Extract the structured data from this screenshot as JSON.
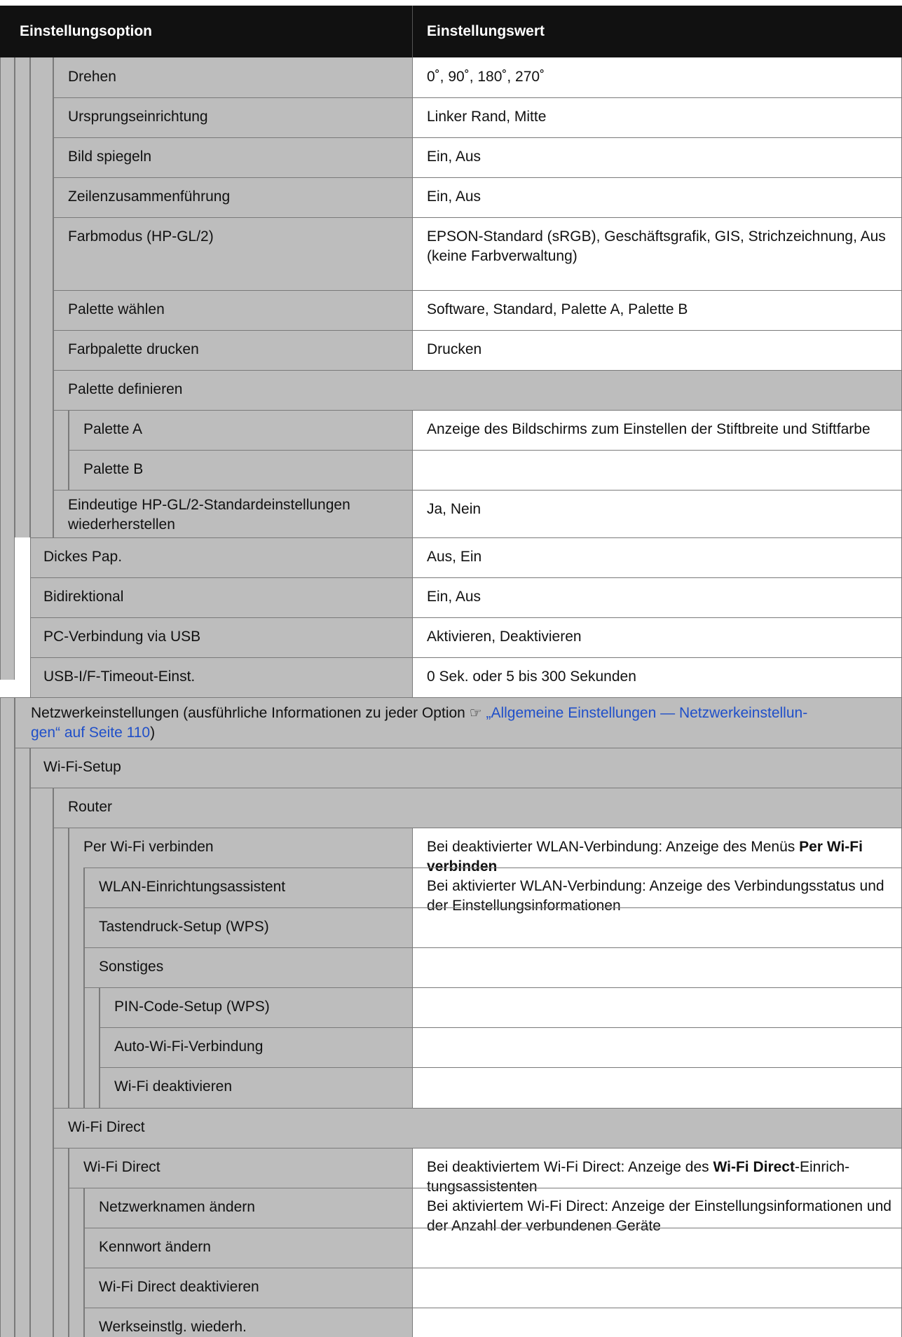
{
  "header": {
    "option": "Einstellungsoption",
    "value": "Einstellungswert"
  },
  "rows": {
    "drehen": {
      "option": "Drehen",
      "value": "0˚, 90˚, 180˚, 270˚"
    },
    "ursprung": {
      "option": "Ursprungseinrichtung",
      "value": "Linker Rand, Mitte"
    },
    "spiegeln": {
      "option": "Bild spiegeln",
      "value": "Ein, Aus"
    },
    "zeilen": {
      "option": "Zeilenzusammenführung",
      "value": "Ein, Aus"
    },
    "farbmodus": {
      "option": "Farbmodus (HP-GL/2)",
      "value": "EPSON-Standard (sRGB), Geschäftsgrafik, GIS, Strichzeichnung, Aus (keine Farbverwaltung)"
    },
    "palette_waehlen": {
      "option": "Palette wählen",
      "value": "Software, Standard, Palette A, Palette B"
    },
    "farbpalette": {
      "option": "Farbpalette drucken",
      "value": "Drucken"
    },
    "palette_def": {
      "option": "Palette definieren"
    },
    "palette_a": {
      "option": "Palette A"
    },
    "palette_b": {
      "option": "Palette B"
    },
    "palette_ab_value": "Anzeige des Bildschirms zum Einstellen der Stiftbreite und Stiftfarbe",
    "eindeutig": {
      "option": "Eindeutige HP-GL/2-Standardeinstellungen wiederherstellen",
      "value": "Ja, Nein"
    },
    "dickes": {
      "option": "Dickes Pap.",
      "value": "Aus, Ein"
    },
    "bidi": {
      "option": "Bidirektional",
      "value": "Ein, Aus"
    },
    "pc_usb": {
      "option": "PC-Verbindung via USB",
      "value": "Aktivieren, Deaktivieren"
    },
    "usb_timeout": {
      "option": "USB-I/F-Timeout-Einst.",
      "value": "0 Sek. oder 5 bis 300 Sekunden"
    }
  },
  "netzwerk": {
    "text": "Netzwerkeinstellungen (ausführliche Informationen zu jeder Option",
    "icon": "pointing-hand-icon",
    "link_text_1": "„Allgemeine Einstellungen — Netzwerkeinstellun-",
    "link_text_2": "gen“ auf Seite 110",
    "close": ")"
  },
  "wifi": {
    "setup": "Wi-Fi-Setup",
    "router": "Router",
    "per_wifi": "Per Wi-Fi verbinden",
    "wlan_assist": "WLAN-Einrichtungsassistent",
    "tastendruck": "Tastendruck-Setup (WPS)",
    "sonstiges": "Sonstiges",
    "pin": "PIN-Code-Setup (WPS)",
    "auto": "Auto-Wi-Fi-Verbindung",
    "deaktivieren": "Wi-Fi deaktivieren",
    "value": {
      "line1_pre": "Bei deaktivierter WLAN-Verbindung: Anzeige des Menüs ",
      "line1_bold": "Per Wi-Fi verbinden",
      "line2": "Bei aktivierter WLAN-Verbindung: Anzeige des Verbindungsstatus und der Einstellungsinformationen"
    }
  },
  "wifi_direct": {
    "group": "Wi-Fi Direct",
    "item": "Wi-Fi Direct",
    "netz_name": "Netzwerknamen ändern",
    "kennwort": "Kennwort ändern",
    "deaktivieren": "Wi-Fi Direct deaktivieren",
    "werk": "Werkseinstlg. wiederh.",
    "value": {
      "line1_pre": "Bei deaktiviertem Wi-Fi Direct: Anzeige des ",
      "line1_bold": "Wi-Fi Direct",
      "line1_post": "-Einrich-tungsassistenten",
      "line2": "Bei aktiviertem Wi-Fi Direct: Anzeige der Einstellungsinformationen und der Anzahl der verbundenen Geräte"
    }
  }
}
